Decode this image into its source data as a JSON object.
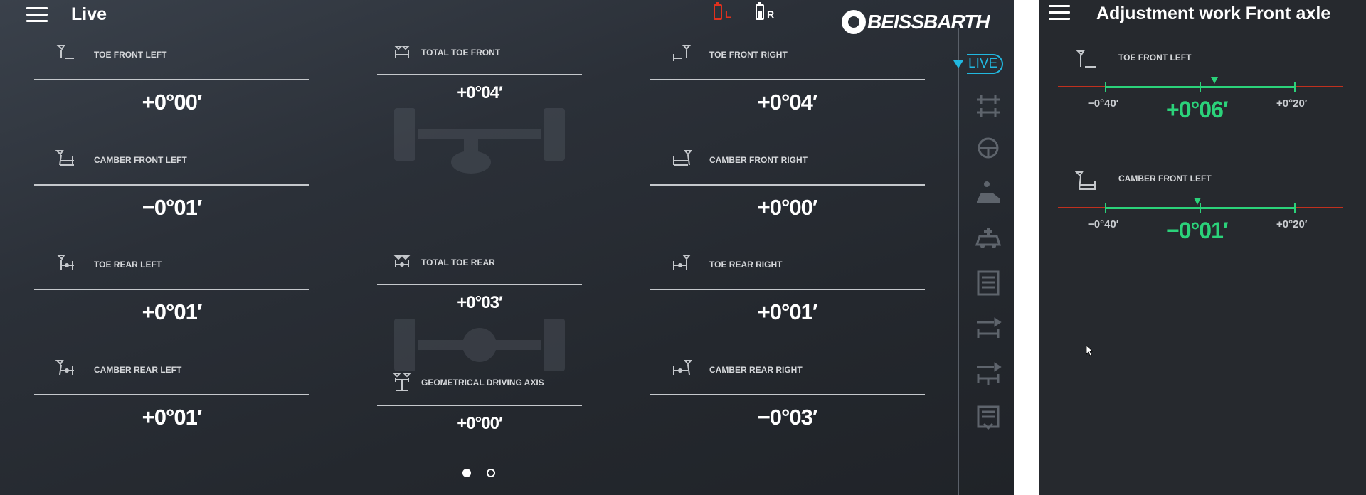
{
  "live": {
    "title": "Live",
    "battery_left": {
      "label": "L",
      "color": "#e0311e"
    },
    "battery_right": {
      "label": "R",
      "color": "#ffffff"
    },
    "logo_text": "BEISSBARTH",
    "front": {
      "toe_left": {
        "label": "TOE FRONT LEFT",
        "value": "+0°00′"
      },
      "total_toe": {
        "label": "TOTAL TOE FRONT",
        "value": "+0°04′"
      },
      "toe_right": {
        "label": "TOE FRONT RIGHT",
        "value": "+0°04′"
      },
      "camber_left": {
        "label": "CAMBER FRONT LEFT",
        "value": "−0°01′"
      },
      "camber_right": {
        "label": "CAMBER FRONT RIGHT",
        "value": "+0°00′"
      }
    },
    "rear": {
      "toe_left": {
        "label": "TOE REAR LEFT",
        "value": "+0°01′"
      },
      "total_toe": {
        "label": "TOTAL TOE REAR",
        "value": "+0°03′"
      },
      "toe_right": {
        "label": "TOE REAR RIGHT",
        "value": "+0°01′"
      },
      "camber_left": {
        "label": "CAMBER REAR LEFT",
        "value": "+0°01′"
      },
      "geo_axis": {
        "label": "GEOMETRICAL DRIVING AXIS",
        "value": "+0°00′"
      },
      "camber_right": {
        "label": "CAMBER REAR RIGHT",
        "value": "−0°03′"
      }
    },
    "sidebar": {
      "live_label": "LIVE",
      "accent": "#21b8e0",
      "icons": [
        "axle-alignment-icon",
        "steering-wheel-icon",
        "driver-seat-icon",
        "vehicle-check-icon",
        "report-icon",
        "wrench-front-axle-icon",
        "wrench-rear-axle-icon",
        "print-list-icon"
      ]
    },
    "pager": {
      "pages": 2,
      "active": 1
    }
  },
  "adjustment": {
    "title": "Adjustment work Front axle",
    "items": [
      {
        "label": "TOE FRONT LEFT",
        "min": "−0°40′",
        "max": "+0°20′",
        "value": "+0°06′",
        "position": 0.55
      },
      {
        "label": "CAMBER FRONT LEFT",
        "min": "−0°40′",
        "max": "+0°20′",
        "value": "−0°01′",
        "position": 0.49
      }
    ],
    "ok_color": "#2bd27a",
    "out_color": "#c0301e"
  }
}
